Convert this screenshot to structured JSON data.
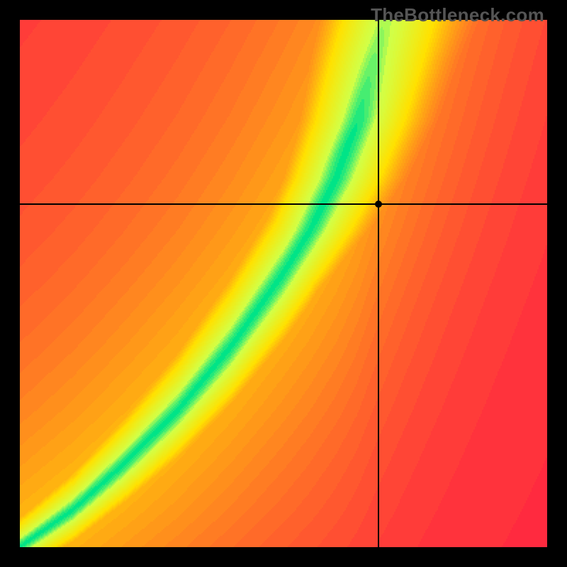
{
  "watermark": "TheBottleneck.com",
  "chart_data": {
    "type": "heatmap",
    "description": "Bottleneck heatmap. X axis = CPU score (0–100), Y axis = GPU score (0–100). Color encodes deviation from the ideal CPU↔GPU pairing: green = balanced, yellow = mild bottleneck, red = severe bottleneck. The green ridge follows the optimal pairing curve; black crosshairs mark the current system point.",
    "x_range": [
      0,
      100
    ],
    "y_range": [
      0,
      100
    ],
    "xlabel": "",
    "ylabel": "",
    "title": "",
    "color_scale": {
      "0": "#ff2a3f",
      "0.5": "#ffe100",
      "0.85": "#e6ff4d",
      "1": "#00e487"
    },
    "ideal_curve_samples": [
      {
        "x": 0,
        "y": 0
      },
      {
        "x": 10,
        "y": 7
      },
      {
        "x": 20,
        "y": 16
      },
      {
        "x": 30,
        "y": 26
      },
      {
        "x": 40,
        "y": 38
      },
      {
        "x": 50,
        "y": 52
      },
      {
        "x": 55,
        "y": 60
      },
      {
        "x": 60,
        "y": 70
      },
      {
        "x": 64,
        "y": 81
      },
      {
        "x": 67,
        "y": 93
      },
      {
        "x": 69,
        "y": 100
      }
    ],
    "marker": {
      "x": 68,
      "y": 65,
      "balanced": false
    }
  }
}
